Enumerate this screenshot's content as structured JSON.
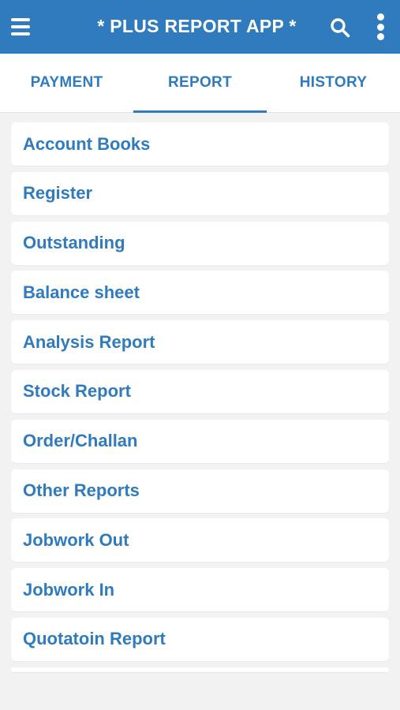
{
  "appbar": {
    "title": "* PLUS REPORT APP *",
    "color": "#2f7bbd",
    "icons": [
      "hamburger-menu-icon",
      "search-icon",
      "more-vertical-icon"
    ]
  },
  "tabs": [
    {
      "label": "PAYMENT",
      "active": false
    },
    {
      "label": "REPORT",
      "active": true
    },
    {
      "label": "HISTORY",
      "active": false
    }
  ],
  "report_items": [
    "Account Books",
    "Register",
    "Outstanding",
    "Balance sheet",
    "Analysis Report",
    "Stock Report",
    "Order/Challan",
    "Other Reports",
    "Jobwork Out",
    "Jobwork In",
    "Quotatoin Report"
  ]
}
